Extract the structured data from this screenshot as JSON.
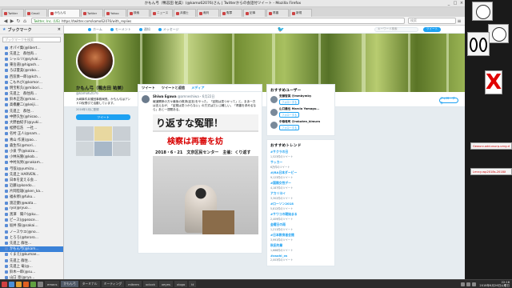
{
  "window": {
    "title": "かもん弓（鴨志田 祐美）(@kamo62076)さん | Twitterからの会話付ツイート - Mozilla Firefox",
    "controls": [
      "_",
      "□",
      "×"
    ]
  },
  "tabs": [
    {
      "label": "Twitter",
      "active": false
    },
    {
      "label": "Gmail",
      "active": false
    },
    {
      "label": "かもん弓",
      "active": true
    },
    {
      "label": "Twitter",
      "active": false
    },
    {
      "label": "Yahoo",
      "active": false
    },
    {
      "label": "検索",
      "active": false
    },
    {
      "label": "ニュース",
      "active": false
    },
    {
      "label": "弁護士",
      "active": false
    },
    {
      "label": "裁判",
      "active": false
    },
    {
      "label": "冤罪",
      "active": false
    },
    {
      "label": "記事",
      "active": false
    },
    {
      "label": "再審",
      "active": false
    },
    {
      "label": "新規",
      "active": false
    }
  ],
  "navbar": {
    "url_secure": "Twitter, Inc. (US)",
    "url": "https://twitter.com/kamo62076/with_replies",
    "search_placeholder": "検索"
  },
  "sidebar": {
    "title": "ブックマーク",
    "close": "×",
    "search_placeholder": "ブックマークを検索",
    "items": [
      {
        "label": "オパイ集(@libert…",
        "selected": false
      },
      {
        "label": "先進上　群住再…",
        "selected": false
      },
      {
        "label": "シャルリ(@sylvai…",
        "selected": false
      },
      {
        "label": "東岳道(@higash…",
        "selected": false
      },
      {
        "label": "ろぼ夏美(@robo…",
        "selected": false
      },
      {
        "label": "西窓奏一郎(@kch…",
        "selected": false
      },
      {
        "label": "こもれび(@komor…",
        "selected": false
      },
      {
        "label": "明宝彰久(@mibori…",
        "selected": false
      },
      {
        "label": "先進上　群住再…",
        "selected": false
      },
      {
        "label": "鈴木正浩(@mas…",
        "selected": false
      },
      {
        "label": "高橋慶二(@keiji…",
        "selected": false
      },
      {
        "label": "先進上　群住…",
        "selected": false
      },
      {
        "label": "中野久生(@hisao…",
        "selected": false
      },
      {
        "label": "大野由紀子(@yuki…",
        "selected": false
      },
      {
        "label": "松野信浩　一社…",
        "selected": false
      },
      {
        "label": "名村 正人(@nam…",
        "selected": false
      },
      {
        "label": "青山 作道(@ao…",
        "selected": false
      },
      {
        "label": "森生作(@mori…",
        "selected": false
      },
      {
        "label": "小泉 学(@koizu…",
        "selected": false
      },
      {
        "label": "小林光隆(@kob…",
        "selected": false
      },
      {
        "label": "中村光男(@nakam…",
        "selected": false
      },
      {
        "label": "弓弦(@yumizu…",
        "selected": false
      },
      {
        "label": "先進上 HARVEN…",
        "selected": false
      },
      {
        "label": "日本を変える会…",
        "selected": false
      },
      {
        "label": "近藤(@kondo…",
        "selected": false
      },
      {
        "label": "片岡陸雄(@ken_ka…",
        "selected": false
      },
      {
        "label": "福永修(@fuku…",
        "selected": false
      },
      {
        "label": "渡辺健(@wata…",
        "selected": false
      },
      {
        "label": "ryo(@ryuo…",
        "selected": false
      },
      {
        "label": "黒澤　陽介(@ku…",
        "selected": false
      },
      {
        "label": "ピース(@peace…",
        "selected": false
      },
      {
        "label": "坂井 照(@sakai…",
        "selected": false
      },
      {
        "label": "ノースウエ(@no…",
        "selected": false
      },
      {
        "label": "とろろ(@tororo…",
        "selected": false
      },
      {
        "label": "先進上 群住…",
        "selected": false
      },
      {
        "label": "かもん弓(@kam…",
        "selected": true
      },
      {
        "label": "くまえ(@kumae…",
        "selected": false
      },
      {
        "label": "先進上 群住…",
        "selected": false
      },
      {
        "label": "先進上 竜(@…",
        "selected": false
      },
      {
        "label": "鈴木一郎(@su…",
        "selected": false
      },
      {
        "label": "山口 亮(@ryo…",
        "selected": false
      }
    ]
  },
  "twitter_nav": {
    "items": [
      "ホーム",
      "モーメント",
      "通知",
      "メッセージ"
    ],
    "logo": "🐦",
    "search_placeholder": "キーワード検索",
    "tweet_button": "ツイート"
  },
  "profile": {
    "stats": [
      {
        "label": "ツイート",
        "value": "1,369"
      },
      {
        "label": "フォロー",
        "value": "98"
      },
      {
        "label": "フォロワー",
        "value": "1,912"
      },
      {
        "label": "いいね",
        "value": "331"
      }
    ],
    "follow_button": "フォローする",
    "name": "かもん弓（鴨志田 祐美）",
    "handle": "@kamo62076",
    "bio": "大崎事件弁護団事務局長。かもん弓はアンドロ仮想引で活動しています。",
    "joined": "2016年1月に登録",
    "tweet_to_button": "ツイート"
  },
  "timeline": {
    "tabs": [
      {
        "label": "ツイート",
        "on": false
      },
      {
        "label": "ツイートと返信",
        "on": false
      },
      {
        "label": "メディア",
        "on": true
      }
    ],
    "tweet": {
      "name": "Shiwa Egawa",
      "handle": "@amneshiwa・6月22日",
      "text": "報道関係の方々最後の救済(証言)をやった。「証拠は見つかって」と。まあ一方は言えるが、「証拠は見つからない」の方式はだいぶ難しい。「再審を求めるなら」あと一週間ある。"
    },
    "photo": {
      "banner_line1": "り返すな冤罪！",
      "banner_line2": "検察は再審を妨",
      "banner_line3": "2018・6・21　文京区民センター　主催：くり返す"
    }
  },
  "right": {
    "suggest_title": "おすすめユーザー",
    "suggestions": [
      {
        "name": "安藤智美 @mmbymby",
        "follow": "フォローする"
      },
      {
        "name": "山口義也 Marcia Yamagu…",
        "follow": "フォローする"
      },
      {
        "name": "中條竜司 @rakuten_kimura",
        "follow": "フォローする"
      }
    ],
    "trends_title": "おすすめトレンド",
    "trends": [
      {
        "name": "#サクラの日",
        "count": "1,523件のツイート"
      },
      {
        "name": "サッカー",
        "count": "6万件のツイート"
      },
      {
        "name": "#JRA日本ダービー",
        "count": "9,123件のツイート"
      },
      {
        "name": "#国際女性デー",
        "count": "4,187件のツイート"
      },
      {
        "name": "アカリヨイ",
        "count": "3,302件のツイート"
      },
      {
        "name": "#ローソン2018",
        "count": "5,812件のツイート"
      },
      {
        "name": "#サワコの朝始まる",
        "count": "2,409件のツイート"
      },
      {
        "name": "金曜日の雨",
        "count": "1,211件のツイート"
      },
      {
        "name": "#日本教育者会館",
        "count": "3,991件のツイート"
      },
      {
        "name": "秋田先輩",
        "count": "1,688件のツイート"
      },
      {
        "name": "#asahi_xs",
        "count": "2,003件のツイート"
      }
    ]
  },
  "desktop": {
    "xbox_glyph": "X",
    "memos": [
      "Gewurz-add-xsurp-urng.d",
      "Lmrcy-wp2018s-2018X"
    ]
  },
  "taskbar": {
    "items": [
      {
        "label": "emacs",
        "on": false
      },
      {
        "label": "かもん弓",
        "on": true
      },
      {
        "label": "ターミナル",
        "on": false
      },
      {
        "label": "ミーティング",
        "on": false
      },
      {
        "label": "mlterm",
        "on": false
      },
      {
        "label": "xclock",
        "on": false
      },
      {
        "label": "xeyes",
        "on": false
      },
      {
        "label": "xlogo",
        "on": false
      },
      {
        "label": "tt",
        "on": false
      }
    ],
    "time": "22:18",
    "date": "2018年6月26日火曜日"
  },
  "colors": {
    "twitter_blue": "#1da1f2",
    "sidebar_selected": "#3b82d8",
    "photo_red": "#d80000"
  }
}
